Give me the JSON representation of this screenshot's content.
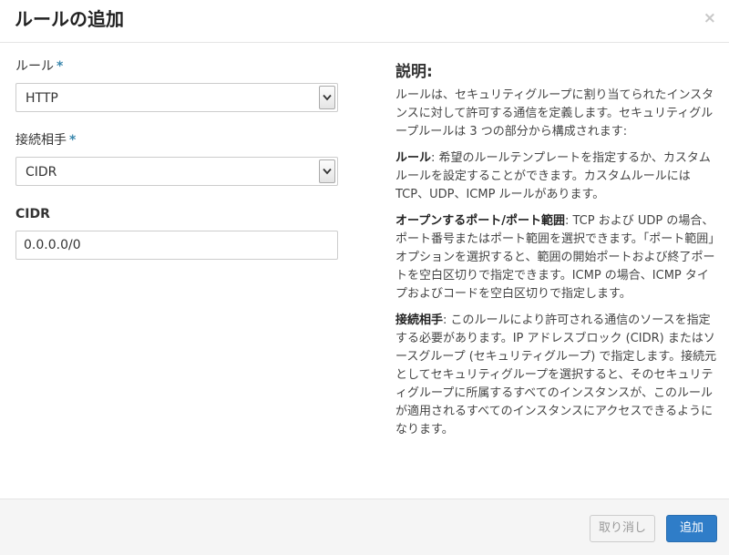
{
  "dialog": {
    "title": "ルールの追加",
    "close_glyph": "×"
  },
  "form": {
    "rule": {
      "label": "ルール",
      "required": "*",
      "value": "HTTP"
    },
    "remote": {
      "label": "接続相手",
      "required": "*",
      "value": "CIDR"
    },
    "cidr": {
      "label": "CIDR",
      "value": "0.0.0.0/0"
    }
  },
  "help": {
    "title": "説明:",
    "intro": "ルールは、セキュリティグループに割り当てられたインスタンスに対して許可する通信を定義します。セキュリティグループルールは 3 つの部分から構成されます:",
    "rule_term": "ルール",
    "rule_text": ": 希望のルールテンプレートを指定するか、カスタムルールを設定することができます。カスタムルールには TCP、UDP、ICMP ルールがあります。",
    "port_term": "オープンするポート/ポート範囲",
    "port_text": ": TCP および UDP の場合、ポート番号またはポート範囲を選択できます。「ポート範囲」オプションを選択すると、範囲の開始ポートおよび終了ポートを空白区切りで指定できます。ICMP の場合、ICMP タイプおよびコードを空白区切りで指定します。",
    "remote_term": "接続相手",
    "remote_text": ": このルールにより許可される通信のソースを指定する必要があります。IP アドレスブロック (CIDR) またはソースグループ (セキュリティグループ) で指定します。接続元としてセキュリティグループを選択すると、そのセキュリティグループに所属するすべてのインスタンスが、このルールが適用されるすべてのインスタンスにアクセスできるようになります。"
  },
  "footer": {
    "cancel_label": "取り消し",
    "submit_label": "追加"
  },
  "colors": {
    "primary_button": "#2f7dc8",
    "required_marker": "#3a87ad"
  }
}
